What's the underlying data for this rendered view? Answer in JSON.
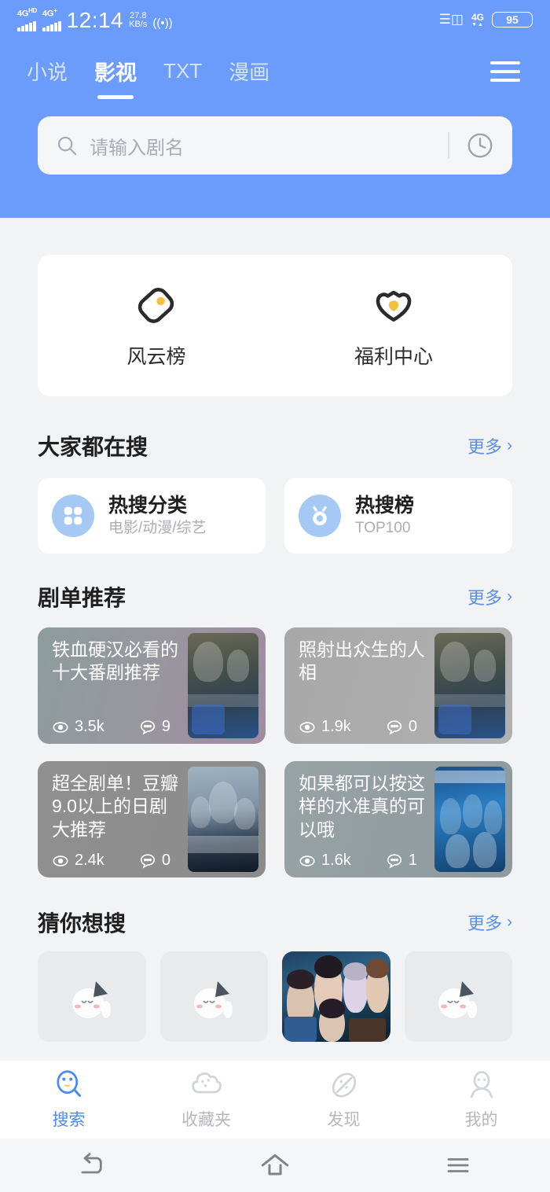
{
  "status_bar": {
    "signal1_label": "4G",
    "signal1_sup": "HD",
    "signal2_label": "4G",
    "signal2_sup": "+",
    "time": "12:14",
    "net_speed_value": "27.8",
    "net_speed_unit": "KB/s",
    "hotspot_icon": "hotspot-icon",
    "vibrate_icon": "vibrate-icon",
    "data_label": "4G",
    "battery_percent": "95"
  },
  "header": {
    "background_color": "#6b9bfb",
    "tabs": [
      {
        "label": "小说",
        "active": false
      },
      {
        "label": "影视",
        "active": true
      },
      {
        "label": "TXT",
        "active": false
      },
      {
        "label": "漫画",
        "active": false
      }
    ],
    "menu_icon": "hamburger-menu-icon",
    "search": {
      "placeholder": "请输入剧名",
      "value": "",
      "search_icon": "search-icon",
      "history_icon": "history-clock-icon"
    }
  },
  "quick_entries": [
    {
      "label": "风云榜",
      "icon": "tag-icon"
    },
    {
      "label": "福利中心",
      "icon": "gift-shield-icon"
    }
  ],
  "sections": {
    "everyone_searching": {
      "title": "大家都在搜",
      "more_label": "更多",
      "cards": [
        {
          "title": "热搜分类",
          "subtitle": "电影/动漫/综艺",
          "icon": "category-grid-icon"
        },
        {
          "title": "热搜榜",
          "subtitle": "TOP100",
          "icon": "medal-icon"
        }
      ]
    },
    "drama_lists": {
      "title": "剧单推荐",
      "more_label": "更多",
      "items": [
        {
          "title": "铁血硬汉必看的十大番剧推荐",
          "views": "3.5k",
          "comments": "9",
          "theme": "dc-a",
          "thumb": "thumb-succession"
        },
        {
          "title": "照射出众生的人相",
          "views": "1.9k",
          "comments": "0",
          "theme": "dc-b",
          "thumb": "thumb-succession"
        },
        {
          "title": "超全剧单！豆瓣9.0以上的日剧大推荐",
          "views": "2.4k",
          "comments": "0",
          "theme": "dc-c",
          "thumb": "thumb-hakui"
        },
        {
          "title": "如果都可以按这样的水准真的可以哦",
          "views": "1.6k",
          "comments": "1",
          "theme": "dc-d",
          "thumb": "thumb-tiaodong"
        }
      ]
    },
    "guess_you_search": {
      "title": "猜你想搜",
      "more_label": "更多",
      "items": [
        {
          "loaded": false,
          "placeholder_icon": "cat-placeholder-icon"
        },
        {
          "loaded": false,
          "placeholder_icon": "cat-placeholder-icon"
        },
        {
          "loaded": true,
          "placeholder_icon": "anime-poster-thumbnail"
        },
        {
          "loaded": false,
          "placeholder_icon": "cat-placeholder-icon"
        }
      ]
    }
  },
  "bottom_nav": {
    "active_color": "#4a8af4",
    "items": [
      {
        "label": "搜索",
        "icon": "search-face-icon",
        "active": true
      },
      {
        "label": "收藏夹",
        "icon": "favorites-cloud-icon",
        "active": false
      },
      {
        "label": "发现",
        "icon": "discover-planet-icon",
        "active": false
      },
      {
        "label": "我的",
        "icon": "profile-person-icon",
        "active": false
      }
    ]
  },
  "system_nav": [
    {
      "icon": "back-icon"
    },
    {
      "icon": "home-icon"
    },
    {
      "icon": "recents-icon"
    }
  ]
}
